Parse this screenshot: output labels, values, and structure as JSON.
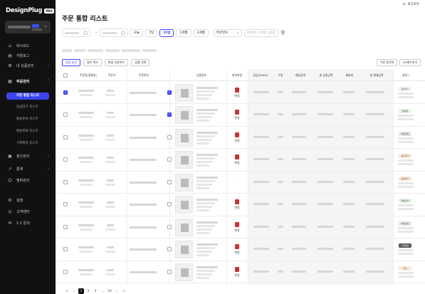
{
  "brand": {
    "logo_text": "DesignPlug",
    "logo_badge": "PRO"
  },
  "header": {
    "logout": "로그아웃"
  },
  "sidebar": {
    "items": [
      {
        "label": "대시보드",
        "icon": "dashboard-icon"
      },
      {
        "label": "카탈로그",
        "icon": "catalog-icon"
      },
      {
        "label": "내 상품관리",
        "icon": "product-icon"
      },
      {
        "label": "주문관리",
        "icon": "order-icon"
      }
    ],
    "order_sub": [
      "주문 통합 리스트",
      "입금대기 리스트",
      "배송준비 리스트",
      "배송완료 리스트",
      "구매확정 리스트"
    ],
    "items2": [
      {
        "label": "정산관리",
        "icon": "settlement-icon"
      },
      {
        "label": "통계",
        "icon": "stats-icon"
      },
      {
        "label": "멤버관리",
        "icon": "member-icon"
      }
    ],
    "bottom": [
      {
        "label": "설정",
        "icon": "settings-icon"
      },
      {
        "label": "고객센터",
        "icon": "support-icon"
      },
      {
        "label": "1:1 문의",
        "icon": "inquiry-icon"
      }
    ]
  },
  "page": {
    "title": "주문 통합 리스트"
  },
  "filters": {
    "ranges": [
      "오늘",
      "7일",
      "15일",
      "1개월",
      "3개월"
    ],
    "active_range": "15일",
    "search_type": "주문번호",
    "search_placeholder": "주문번호, 고객명, 상품명"
  },
  "actions": {
    "left": [
      "상품 승인",
      "접수 취소",
      "파일 다운로드",
      "상품 선택"
    ],
    "right": [
      "주문 동기화",
      "20개씩 보기"
    ]
  },
  "table": {
    "headers": [
      "주문일(결제일)",
      "주문자",
      "주문번호",
      "상품정보",
      "첨부파일",
      "공급사(SKU)",
      "수량",
      "매입금액",
      "총 상품금액",
      "배송비",
      "총 결제금액",
      "상태"
    ],
    "attach_label": "변경",
    "rows": [
      {
        "checked": true,
        "thumb_checked": true,
        "status": "승인대기",
        "status_color": "#f2f2f2",
        "attach": true
      },
      {
        "checked": false,
        "thumb_checked": true,
        "status": "배송중",
        "status_color": "#e4f4e4",
        "attach": true
      },
      {
        "checked": false,
        "thumb_checked": false,
        "status": "배송완료",
        "status_color": "#e8e8e8",
        "attach": true
      },
      {
        "checked": false,
        "thumb_checked": false,
        "status": "승인대기",
        "status_color": "#fde7d2",
        "attach": true
      },
      {
        "checked": false,
        "thumb_checked": false,
        "status": "승인대기",
        "status_color": "#fde7d2",
        "attach": false
      },
      {
        "checked": false,
        "thumb_checked": false,
        "status": "배송준비",
        "status_color": "#e4f4e4",
        "attach": true
      },
      {
        "checked": false,
        "thumb_checked": false,
        "status": "배송완료",
        "status_color": "#e8e8e8",
        "attach": true
      },
      {
        "checked": false,
        "thumb_checked": false,
        "status": "구매확정",
        "status_color": "#555555",
        "attach": true
      },
      {
        "checked": false,
        "thumb_checked": false,
        "status": "취소",
        "status_color": "#fde7d2",
        "attach": true
      }
    ]
  },
  "pagination": {
    "first": "«",
    "prev": "‹",
    "pages": [
      "1",
      "2",
      "3",
      "…",
      "10"
    ],
    "current": "1",
    "next": "›",
    "last": "»"
  }
}
